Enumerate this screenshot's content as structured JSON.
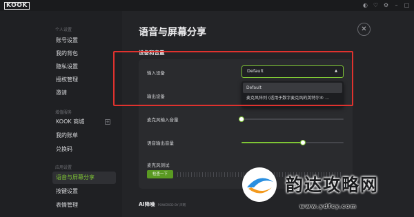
{
  "app": {
    "logo": "KOOK"
  },
  "window_controls": [
    "skin-icon",
    "heart-icon",
    "settings-icon",
    "minimize-icon",
    "close-icon"
  ],
  "sidebar": {
    "groups": [
      {
        "title": "个人设置",
        "items": [
          "账号设置",
          "我的背包",
          "隐私设置",
          "授权管理",
          "邀请"
        ]
      },
      {
        "title": "增值服务",
        "items": [
          "KOOK 商城",
          "我的账单",
          "兑换码"
        ]
      },
      {
        "title": "应用设置",
        "items": [
          "语音与屏幕分享",
          "按键设置",
          "表情管理"
        ]
      }
    ],
    "active_item": "语音与屏幕分享"
  },
  "main": {
    "title": "语音与屏幕分享",
    "section_title": "设备和音量",
    "input_device": {
      "label": "输入设备",
      "value": "Default",
      "options": [
        "Default",
        "麦克风阵列 (适用于数字麦克风的英特尔® ..."
      ]
    },
    "output_device": {
      "label": "输出设备"
    },
    "mic_volume": {
      "label": "麦克风输入音量",
      "level": 0.0
    },
    "output_volume": {
      "label": "语音输出音量",
      "level": 0.6
    },
    "mic_test": {
      "label": "麦克风测试",
      "button": "检查一下"
    },
    "ai_section": {
      "title": "AI降噪",
      "subtitle": "POWERED BY 声网"
    }
  },
  "watermark": {
    "text": "韵达攻略网",
    "url": "www.ydfcy.com"
  },
  "colors": {
    "accent": "#7fc635",
    "highlight": "#e0322e"
  }
}
